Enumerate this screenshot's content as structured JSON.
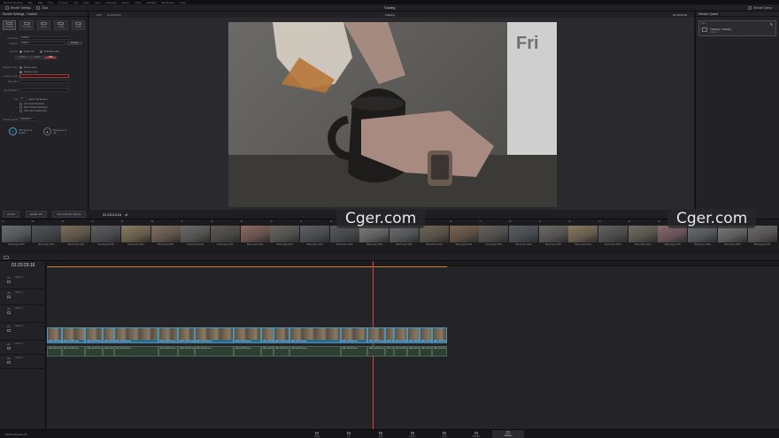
{
  "menu": [
    "DaVinci Resolve",
    "File",
    "Edit",
    "Trim",
    "Timeline",
    "Clip",
    "Mark",
    "View",
    "Playback",
    "Fusion",
    "Color",
    "Fairlight",
    "Workspace",
    "Help"
  ],
  "toolbar": {
    "render_settings": "Render Settings",
    "clips": "Clips",
    "project_title": "Training",
    "render_queue": "Render Queue"
  },
  "render_settings": {
    "header": "Render Settings - Custom",
    "presets": [
      {
        "label": "Custom",
        "selected": true
      },
      {
        "label": "YouTube",
        "selected": false
      },
      {
        "label": "Vimeo",
        "selected": false
      },
      {
        "label": "H.264",
        "selected": false
      },
      {
        "label": "H.265",
        "selected": false
      }
    ],
    "filename_label": "File name",
    "filename_value": "untitled",
    "location_label": "Location",
    "location_value": "/Users/...",
    "browse": "Browse",
    "render_label": "Render",
    "single_clip": "Single clip",
    "individual_clips": "Individual clips",
    "tabs": [
      {
        "label": "Video",
        "active": false
      },
      {
        "label": "Audio",
        "active": false
      },
      {
        "label": "File",
        "active": true
      }
    ],
    "filename_uses_label": "Filename uses",
    "source_name": "Source name",
    "timeline_name": "Timeline name",
    "custom_name_label": "Custom name",
    "custom_name_value": "",
    "file_suffix_label": "File suffix",
    "file_subfolder_label": "File subfolder",
    "use_label": "Use",
    "digits_label": "digits in the filename",
    "digits_value": "8",
    "opt_unique": "Use unique filenames",
    "opt_save_timeline": "Save Timeline Resolution",
    "opt_hide": "Hide clips in Media Pool",
    "render_speed_label": "Render speed",
    "render_speed_value": "Maximum",
    "stick_timeline": "Stick queue to timeline",
    "stick_clip": "Stick queue to clip",
    "btn_cancel": "Cancel",
    "btn_update": "Update Job",
    "btn_add": "Add to Render Queue"
  },
  "viewer": {
    "left_tc": "01:00:00:00",
    "right_tc": "01:23:23:16",
    "clip_label": "Training",
    "zoom": "51%",
    "scrub_tc": "01:23:23:16"
  },
  "render_queue": {
    "header": "Render Queue",
    "job_label": "Job 1",
    "job_title": "Training | Training",
    "job_path": "/Users/..."
  },
  "thumbnails": {
    "labels": [
      "01",
      "02",
      "03",
      "04",
      "05",
      "06",
      "07",
      "08",
      "09",
      "10",
      "11",
      "12",
      "13",
      "14",
      "15",
      "16",
      "17",
      "18",
      "19",
      "20",
      "21",
      "22",
      "23",
      "24",
      "25",
      "26"
    ],
    "caption": "Blackmagic RAW",
    "colors": [
      "#6a6e72",
      "#4e5458",
      "#7a6d5a",
      "#5c5f62",
      "#8a7a62",
      "#7f6f5f",
      "#6d6a68",
      "#5e5a55",
      "#8b6a62",
      "#6a6762",
      "#5d6065",
      "#57595c",
      "#7d7c7a",
      "#6b6d6f",
      "#6f6658",
      "#7a6550",
      "#666360",
      "#5a5f63",
      "#6d6b67",
      "#8a7860",
      "#5e625f",
      "#736b62",
      "#8a6a70",
      "#6a6e72",
      "#7c7a78",
      "#6e6c6a"
    ]
  },
  "timeline": {
    "timecode": "01:23:23:16",
    "tracks": [
      {
        "id": "V4",
        "name": "Video 4"
      },
      {
        "id": "V3",
        "name": "Video 3"
      },
      {
        "id": "V2",
        "name": "Video 2"
      },
      {
        "id": "V1",
        "name": "Video 1"
      },
      {
        "id": "A1",
        "name": "Audio 1"
      },
      {
        "id": "A2",
        "name": "Audio 2"
      }
    ],
    "clip_name": "BMD_B03781.braw"
  },
  "pages": [
    {
      "label": "Media",
      "active": false
    },
    {
      "label": "Cut",
      "active": false
    },
    {
      "label": "Edit",
      "active": false
    },
    {
      "label": "Fusion",
      "active": false
    },
    {
      "label": "Color",
      "active": false
    },
    {
      "label": "Fairlight",
      "active": false
    },
    {
      "label": "Deliver",
      "active": true
    }
  ],
  "brand": "DaVinci Resolve 15",
  "watermark": "Cger.com"
}
